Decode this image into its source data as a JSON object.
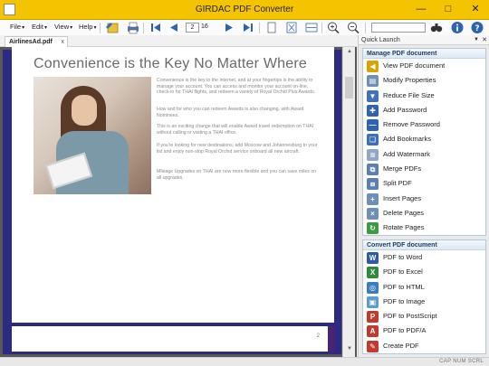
{
  "window": {
    "title": "GIRDAC PDF Converter"
  },
  "menu": [
    {
      "label": "File"
    },
    {
      "label": "Edit"
    },
    {
      "label": "View"
    },
    {
      "label": "Help"
    }
  ],
  "navigation": {
    "current_page": "2",
    "total_pages": "16"
  },
  "tabs": [
    {
      "label": "AirlinesAd.pdf",
      "close": "x"
    }
  ],
  "document": {
    "title": "Convenience is the Key No Matter Where",
    "paragraphs": [
      "Convenience is the key to the internet, and at your fingertips is the ability to manage your account. You can access and monitor your account on-line, check-in for THAI flights, and redeem a variety of Royal Orchid Plus Awards.",
      "How and for who you can redeem Awards is also changing, with Award Nominees.",
      "This is an exciting change that will enable Award travel redemption on THAI without calling or visiting a THAI office.",
      "If you're looking for new destinations, add Moscow and Johannesburg to your list and enjoy non-stop Royal Orchid service onboard all new aircraft.",
      "Mileage Upgrades on THAI are now more flexible and you can save miles on all upgrades."
    ],
    "page2_number": "2"
  },
  "quick_launch": {
    "title": "Quick Launch",
    "manage": {
      "heading": "Manage PDF document",
      "items": [
        {
          "label": "View PDF document",
          "icon": "view-document-icon",
          "color": "#d9a400",
          "glyph": "◀"
        },
        {
          "label": "Modify Properties",
          "icon": "properties-icon",
          "color": "#6f8fb6",
          "glyph": "▤"
        },
        {
          "label": "Reduce File Size",
          "icon": "reduce-size-icon",
          "color": "#3f72b8",
          "glyph": "▼"
        },
        {
          "label": "Add Password",
          "icon": "lock-icon",
          "color": "#2f63b0",
          "glyph": "✚"
        },
        {
          "label": "Remove Password",
          "icon": "unlock-icon",
          "color": "#2f63b0",
          "glyph": "—"
        },
        {
          "label": "Add Bookmarks",
          "icon": "bookmark-icon",
          "color": "#3d6fb5",
          "glyph": "❏"
        },
        {
          "label": "Add Watermark",
          "icon": "watermark-icon",
          "color": "#8fa7c4",
          "glyph": "≋"
        },
        {
          "label": "Merge PDFs",
          "icon": "merge-icon",
          "color": "#5a7fb0",
          "glyph": "⧉"
        },
        {
          "label": "Split PDF",
          "icon": "split-icon",
          "color": "#5a7fb0",
          "glyph": "⧈"
        },
        {
          "label": "Insert Pages",
          "icon": "insert-pages-icon",
          "color": "#6f8fb6",
          "glyph": "+"
        },
        {
          "label": "Delete Pages",
          "icon": "delete-pages-icon",
          "color": "#6f8fb6",
          "glyph": "×"
        },
        {
          "label": "Rotate Pages",
          "icon": "rotate-icon",
          "color": "#3c9a45",
          "glyph": "↻"
        }
      ]
    },
    "convert": {
      "heading": "Convert PDF document",
      "items": [
        {
          "label": "PDF to Word",
          "icon": "word-icon",
          "color": "#2c5aa8",
          "glyph": "W"
        },
        {
          "label": "PDF to Excel",
          "icon": "excel-icon",
          "color": "#2f8a3c",
          "glyph": "X"
        },
        {
          "label": "PDF to HTML",
          "icon": "html-icon",
          "color": "#3b7bc0",
          "glyph": "◎"
        },
        {
          "label": "PDF to Image",
          "icon": "image-icon",
          "color": "#5d9bd1",
          "glyph": "▣"
        },
        {
          "label": "PDF to PostScript",
          "icon": "postscript-icon",
          "color": "#c23a2e",
          "glyph": "P"
        },
        {
          "label": "PDF to PDF/A",
          "icon": "pdfa-icon",
          "color": "#c23a2e",
          "glyph": "A"
        },
        {
          "label": "Create PDF",
          "icon": "create-pdf-icon",
          "color": "#c23a2e",
          "glyph": "✎"
        }
      ]
    }
  },
  "status": {
    "keys": "CAP  NUM  SCRL"
  },
  "colors": {
    "title_bar": "#f5c400",
    "panel_header_text": "#1d3d66",
    "doc_background": "#2b2b84"
  }
}
